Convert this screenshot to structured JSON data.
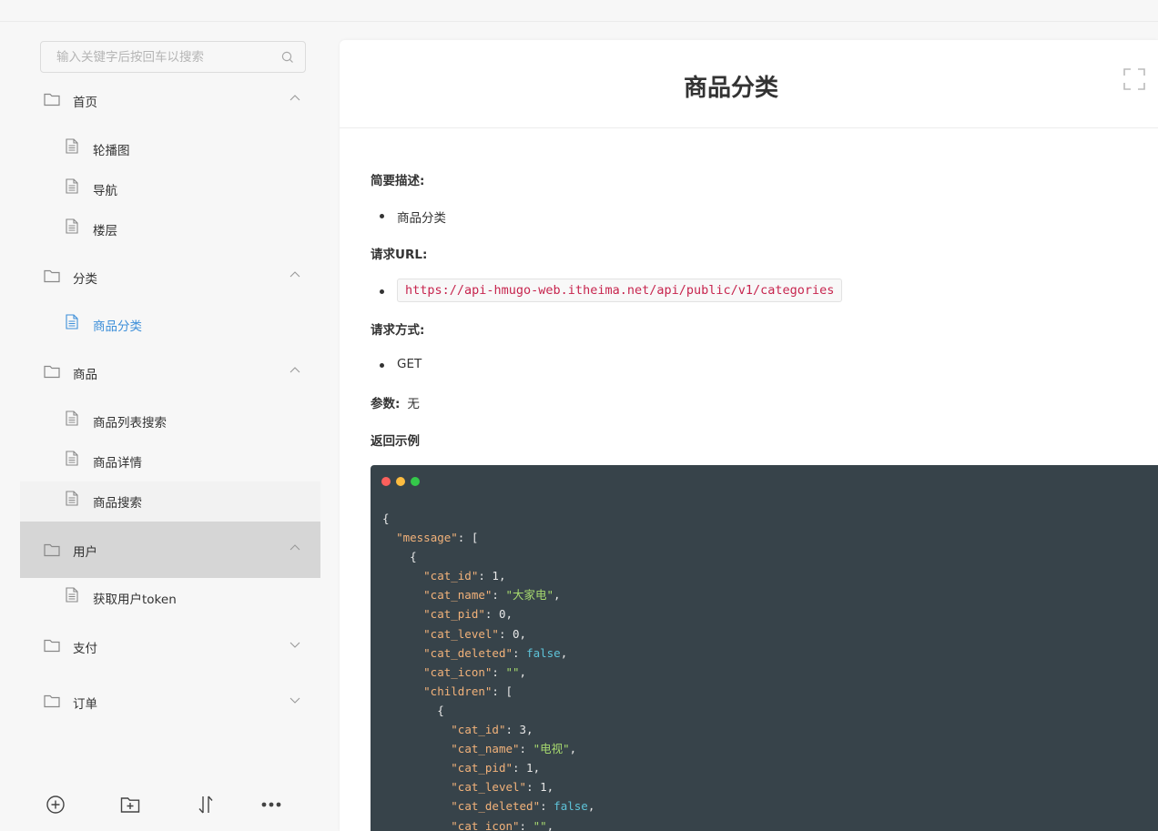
{
  "search": {
    "placeholder": "输入关键字后按回车以搜索"
  },
  "sidebar": {
    "groups": [
      {
        "label": "首页",
        "expanded": true,
        "items": [
          "轮播图",
          "导航",
          "楼层"
        ]
      },
      {
        "label": "分类",
        "expanded": true,
        "items": [
          "商品分类"
        ]
      },
      {
        "label": "商品",
        "expanded": true,
        "items": [
          "商品列表搜索",
          "商品详情",
          "商品搜索"
        ]
      },
      {
        "label": "用户",
        "expanded": true,
        "items": [
          "获取用户token"
        ]
      },
      {
        "label": "支付",
        "expanded": false,
        "items": []
      },
      {
        "label": "订单",
        "expanded": false,
        "items": []
      }
    ],
    "active_item": "商品分类",
    "selected_group": "用户"
  },
  "doc": {
    "title": "商品分类",
    "brief_heading": "简要描述:",
    "brief_item": "商品分类",
    "url_heading": "请求URL:",
    "url": "https://api-hmugo-web.itheima.net/api/public/v1/categories",
    "method_heading": "请求方式:",
    "method": "GET",
    "params_heading": "参数:",
    "params_value": "无",
    "example_heading": "返回示例"
  },
  "code_sample": [
    "{",
    "  \"message\": [",
    "    {",
    "      \"cat_id\": 1,",
    "      \"cat_name\": \"大家电\",",
    "      \"cat_pid\": 0,",
    "      \"cat_level\": 0,",
    "      \"cat_deleted\": false,",
    "      \"cat_icon\": \"\",",
    "      \"children\": [",
    "        {",
    "          \"cat_id\": 3,",
    "          \"cat_name\": \"电视\",",
    "          \"cat_pid\": 1,",
    "          \"cat_level\": 1,",
    "          \"cat_deleted\": false,",
    "          \"cat_icon\": \"\","
  ],
  "colors": {
    "accent": "#3d8fd9",
    "url_text": "#c7254e",
    "code_bg": "#37434a",
    "mac_red": "#fc605c",
    "mac_yellow": "#fdbc40",
    "mac_green": "#34c84a"
  }
}
